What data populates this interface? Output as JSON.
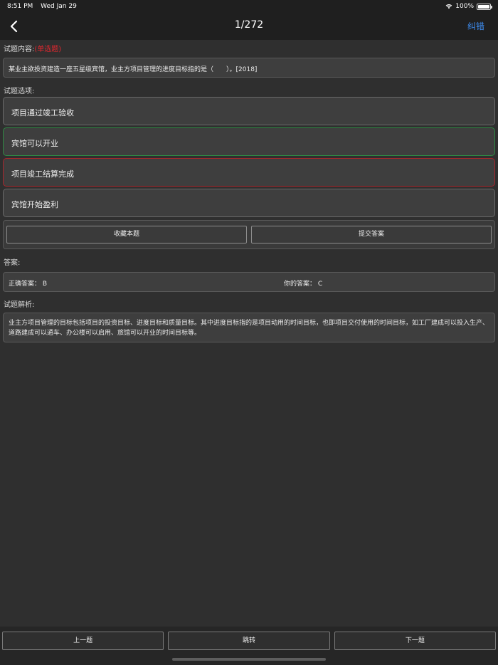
{
  "status_bar": {
    "time": "8:51 PM",
    "date": "Wed Jan 29",
    "battery": "100%",
    "icons": [
      "wifi-icon",
      "battery-icon"
    ]
  },
  "navbar": {
    "back_icon": "chevron-left-icon",
    "title": "1/272",
    "action": "纠错",
    "accent": "#3d8cf0"
  },
  "question": {
    "label": "试题内容:",
    "type": "(单选题)",
    "text": "某业主欲投资建造一座五星级宾馆，业主方项目管理的进度目标指的是（　　）。[2018]"
  },
  "options": {
    "label": "试题选项:",
    "items": [
      {
        "text": "项目通过竣工验收",
        "state": "normal"
      },
      {
        "text": "宾馆可以开业",
        "state": "correct"
      },
      {
        "text": "项目竣工结算完成",
        "state": "wrong"
      },
      {
        "text": "宾馆开始盈利",
        "state": "normal"
      }
    ],
    "correct_color": "#2f8a44",
    "wrong_color": "#a8262c"
  },
  "actions": {
    "favorite": "收藏本题",
    "submit": "提交答案"
  },
  "answer": {
    "label": "答案:",
    "correct": "正确答案：  B",
    "yours": "你的答案：  C"
  },
  "analysis": {
    "label": "试题解析:",
    "text": "业主方项目管理的目标包括项目的投资目标、进度目标和质量目标。其中进度目标指的是项目动用的时间目标，也即项目交付使用的时间目标，如工厂建成可以投入生产、道路建成可以通车、办公楼可以启用、旅馆可以开业的时间目标等。"
  },
  "bottom": {
    "prev": "上一题",
    "jump": "跳转",
    "next": "下一题"
  }
}
